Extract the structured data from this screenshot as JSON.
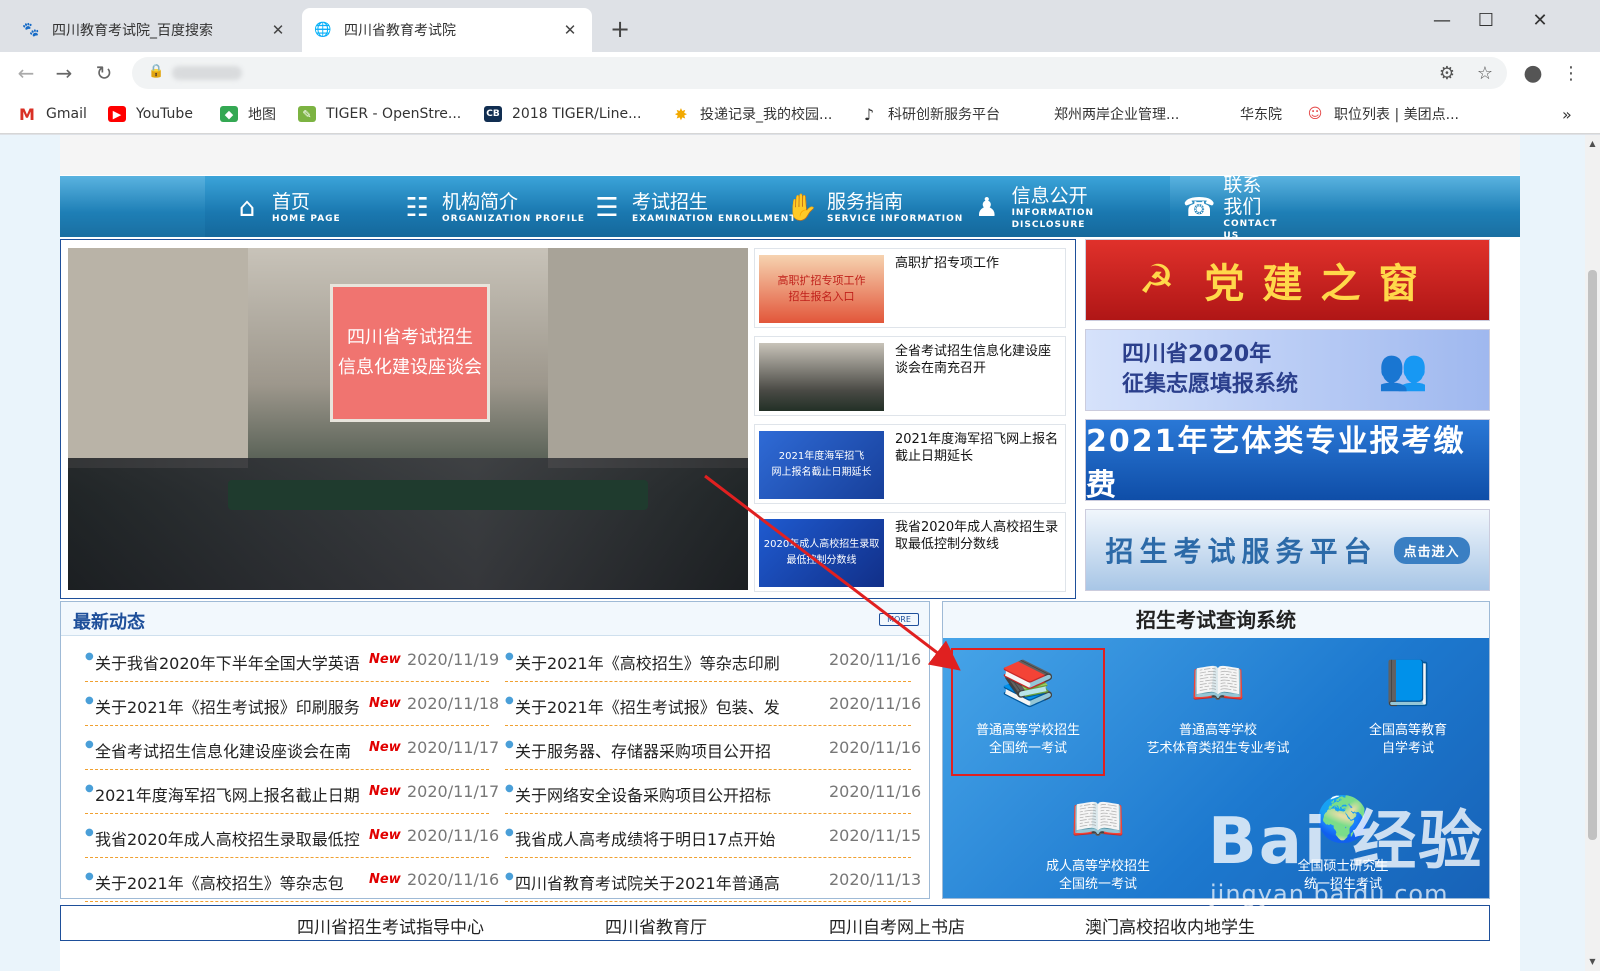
{
  "browser": {
    "tabs": [
      {
        "title": "四川教育考试院_百度搜索",
        "active": false,
        "icon": "baidu-paw-icon"
      },
      {
        "title": "四川省教育考试院",
        "active": true,
        "icon": "globe-icon"
      }
    ],
    "bookmarks": [
      {
        "label": "Gmail",
        "icon": "gmail-icon"
      },
      {
        "label": "YouTube",
        "icon": "youtube-icon"
      },
      {
        "label": "地图",
        "icon": "maps-icon"
      },
      {
        "label": "TIGER - OpenStre...",
        "icon": "tiger-osm-icon"
      },
      {
        "label": "2018 TIGER/Line...",
        "icon": "census-cb-icon"
      },
      {
        "label": "投递记录_我的校园...",
        "icon": "campus-icon"
      },
      {
        "label": "科研创新服务平台",
        "icon": "research-icon"
      },
      {
        "label": "郑州两岸企业管理...",
        "icon": ""
      },
      {
        "label": "华东院",
        "icon": ""
      },
      {
        "label": "职位列表 | 美团点...",
        "icon": "meituan-icon"
      }
    ]
  },
  "nav": [
    {
      "zh": "首页",
      "en": "HOME PAGE",
      "icon": "home-icon"
    },
    {
      "zh": "机构简介",
      "en": "ORGANIZATION PROFILE",
      "icon": "org-chart-icon"
    },
    {
      "zh": "考试招生",
      "en": "EXAMINATION ENROLLMENT",
      "icon": "clipboard-icon"
    },
    {
      "zh": "服务指南",
      "en": "SERVICE INFORMATION",
      "icon": "handshake-icon"
    },
    {
      "zh": "信息公开",
      "en": "INFORMATION DISCLOSURE",
      "icon": "people-icon"
    },
    {
      "zh": "联系我们",
      "en": "CONTACT US",
      "icon": "support-icon"
    }
  ],
  "slide": {
    "screen_line1": "四川省考试招生",
    "screen_line2": "信息化建设座谈会"
  },
  "thumbs": [
    {
      "caption": "高职扩招专项工作",
      "img_text": "高职扩招专项工作\n招生报名入口"
    },
    {
      "caption": "全省考试招生信息化建设座谈会在南充召开",
      "img_text": ""
    },
    {
      "caption": "2021年度海军招飞网上报名截止日期延长",
      "img_text": "2021年度海军招飞\n网上报名截止日期延长"
    },
    {
      "caption": "我省2020年成人高校招生录取最低控制分数线",
      "img_text": "2020年成人高校招生录取\n最低控制分数线"
    }
  ],
  "banners": {
    "party": "党建之窗",
    "volunteer_line1": "四川省2020年",
    "volunteer_line2": "征集志愿填报系统",
    "art": "2021年艺体类专业报考缴费",
    "service": "招生考试服务平台",
    "service_enter": "点击进入"
  },
  "news": {
    "title": "最新动态",
    "more": "MORE",
    "new_tag": "New",
    "left": [
      {
        "text": "关于我省2020年下半年全国大学英语",
        "date": "2020/11/19",
        "new": true
      },
      {
        "text": "关于2021年《招生考试报》印刷服务",
        "date": "2020/11/18",
        "new": true
      },
      {
        "text": "全省考试招生信息化建设座谈会在南",
        "date": "2020/11/17",
        "new": true
      },
      {
        "text": "2021年度海军招飞网上报名截止日期",
        "date": "2020/11/17",
        "new": true
      },
      {
        "text": "我省2020年成人高校招生录取最低控",
        "date": "2020/11/16",
        "new": true
      },
      {
        "text": "关于2021年《高校招生》等杂志包",
        "date": "2020/11/16",
        "new": true
      }
    ],
    "right": [
      {
        "text": "关于2021年《高校招生》等杂志印刷",
        "date": "2020/11/16"
      },
      {
        "text": "关于2021年《招生考试报》包装、发",
        "date": "2020/11/16"
      },
      {
        "text": "关于服务器、存储器采购项目公开招",
        "date": "2020/11/16"
      },
      {
        "text": "关于网络安全设备采购项目公开招标",
        "date": "2020/11/16"
      },
      {
        "text": "我省成人高考成绩将于明日17点开始",
        "date": "2020/11/15"
      },
      {
        "text": "四川省教育考试院关于2021年普通高",
        "date": "2020/11/13"
      }
    ]
  },
  "query": {
    "title": "招生考试查询系统",
    "items": [
      {
        "line1": "普通高等学校招生",
        "line2": "全国统一考试",
        "icon": "books-icon"
      },
      {
        "line1": "普通高等学校",
        "line2": "艺术体育类招生专业考试",
        "icon": "open-book-pen-icon"
      },
      {
        "line1": "全国高等教育",
        "line2": "自学考试",
        "icon": "book-stack-icon"
      },
      {
        "line1": "成人高等学校招生",
        "line2": "全国统一考试",
        "icon": "open-book-icon"
      },
      {
        "line1": "全国硕士研究生",
        "line2": "统一招生考试",
        "icon": "book-globe-icon"
      }
    ]
  },
  "watermark": {
    "logo": "Bai 经验",
    "url": "jingyan.baidu.com"
  },
  "links": [
    "四川省招生考试指导中心",
    "四川省教育厅",
    "四川自考网上书店",
    "澳门高校招收内地学生"
  ],
  "colors": {
    "annotation": "#e02020",
    "nav_blue": "#1a78b0",
    "news_title": "#1e4f9a",
    "new_tag": "#e10000"
  }
}
